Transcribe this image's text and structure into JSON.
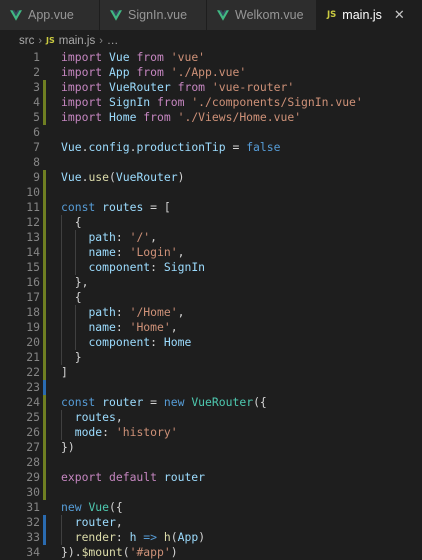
{
  "tabs": [
    {
      "label": "App.vue",
      "type": "vue",
      "active": false
    },
    {
      "label": "SignIn.vue",
      "type": "vue",
      "active": false
    },
    {
      "label": "Welkom.vue",
      "type": "vue",
      "active": false
    },
    {
      "label": "main.js",
      "type": "js",
      "active": true
    }
  ],
  "tab_close_glyph": "✕",
  "file_badge": "JS",
  "breadcrumb": {
    "folder": "src",
    "file": "main.js",
    "more": "…",
    "separator": "›"
  },
  "lines": [
    {
      "n": "1",
      "mark": "",
      "tokens": [
        [
          "kw",
          "import "
        ],
        [
          "id",
          "Vue"
        ],
        [
          "kw",
          " from "
        ],
        [
          "str",
          "'vue'"
        ]
      ]
    },
    {
      "n": "2",
      "mark": "",
      "tokens": [
        [
          "kw",
          "import "
        ],
        [
          "id",
          "App"
        ],
        [
          "kw",
          " from "
        ],
        [
          "str",
          "'./App.vue'"
        ]
      ]
    },
    {
      "n": "3",
      "mark": "g",
      "tokens": [
        [
          "kw",
          "import "
        ],
        [
          "id",
          "VueRouter"
        ],
        [
          "kw",
          " from "
        ],
        [
          "str",
          "'vue-router'"
        ]
      ]
    },
    {
      "n": "4",
      "mark": "g",
      "tokens": [
        [
          "kw",
          "import "
        ],
        [
          "id",
          "SignIn"
        ],
        [
          "kw",
          " from "
        ],
        [
          "str",
          "'./components/SignIn.vue'"
        ]
      ]
    },
    {
      "n": "5",
      "mark": "g",
      "tokens": [
        [
          "kw",
          "import "
        ],
        [
          "id",
          "Home"
        ],
        [
          "kw",
          " from "
        ],
        [
          "str",
          "'./Views/Home.vue'"
        ]
      ]
    },
    {
      "n": "6",
      "mark": "",
      "tokens": []
    },
    {
      "n": "7",
      "mark": "",
      "tokens": [
        [
          "id",
          "Vue"
        ],
        [
          "pl",
          "."
        ],
        [
          "id",
          "config"
        ],
        [
          "pl",
          "."
        ],
        [
          "id",
          "productionTip"
        ],
        [
          "pl",
          " = "
        ],
        [
          "dk",
          "false"
        ]
      ]
    },
    {
      "n": "8",
      "mark": "",
      "tokens": []
    },
    {
      "n": "9",
      "mark": "g",
      "tokens": [
        [
          "id",
          "Vue"
        ],
        [
          "pl",
          "."
        ],
        [
          "fn",
          "use"
        ],
        [
          "pl",
          "("
        ],
        [
          "id",
          "VueRouter"
        ],
        [
          "pl",
          ")"
        ]
      ]
    },
    {
      "n": "10",
      "mark": "g",
      "tokens": []
    },
    {
      "n": "11",
      "mark": "g",
      "tokens": [
        [
          "dk",
          "const "
        ],
        [
          "id",
          "routes"
        ],
        [
          "pl",
          " = ["
        ]
      ]
    },
    {
      "n": "12",
      "mark": "g",
      "tokens": [
        [
          "pl",
          "  {"
        ]
      ]
    },
    {
      "n": "13",
      "mark": "g",
      "tokens": [
        [
          "pl",
          "    "
        ],
        [
          "id",
          "path"
        ],
        [
          "pl",
          ": "
        ],
        [
          "str",
          "'/'"
        ],
        [
          "pl",
          ","
        ]
      ]
    },
    {
      "n": "14",
      "mark": "g",
      "tokens": [
        [
          "pl",
          "    "
        ],
        [
          "id",
          "name"
        ],
        [
          "pl",
          ": "
        ],
        [
          "str",
          "'Login'"
        ],
        [
          "pl",
          ","
        ]
      ]
    },
    {
      "n": "15",
      "mark": "g",
      "tokens": [
        [
          "pl",
          "    "
        ],
        [
          "id",
          "component"
        ],
        [
          "pl",
          ": "
        ],
        [
          "id",
          "SignIn"
        ]
      ]
    },
    {
      "n": "16",
      "mark": "g",
      "tokens": [
        [
          "pl",
          "  },"
        ]
      ]
    },
    {
      "n": "17",
      "mark": "g",
      "tokens": [
        [
          "pl",
          "  {"
        ]
      ]
    },
    {
      "n": "18",
      "mark": "g",
      "tokens": [
        [
          "pl",
          "    "
        ],
        [
          "id",
          "path"
        ],
        [
          "pl",
          ": "
        ],
        [
          "str",
          "'/Home'"
        ],
        [
          "pl",
          ","
        ]
      ]
    },
    {
      "n": "19",
      "mark": "g",
      "tokens": [
        [
          "pl",
          "    "
        ],
        [
          "id",
          "name"
        ],
        [
          "pl",
          ": "
        ],
        [
          "str",
          "'Home'"
        ],
        [
          "pl",
          ","
        ]
      ]
    },
    {
      "n": "20",
      "mark": "g",
      "tokens": [
        [
          "pl",
          "    "
        ],
        [
          "id",
          "component"
        ],
        [
          "pl",
          ": "
        ],
        [
          "id",
          "Home"
        ]
      ]
    },
    {
      "n": "21",
      "mark": "g",
      "tokens": [
        [
          "pl",
          "  }"
        ]
      ]
    },
    {
      "n": "22",
      "mark": "g",
      "tokens": [
        [
          "pl",
          "]"
        ]
      ]
    },
    {
      "n": "23",
      "mark": "b",
      "tokens": []
    },
    {
      "n": "24",
      "mark": "g",
      "tokens": [
        [
          "dk",
          "const "
        ],
        [
          "id",
          "router"
        ],
        [
          "pl",
          " = "
        ],
        [
          "dk",
          "new "
        ],
        [
          "cls",
          "VueRouter"
        ],
        [
          "pl",
          "({"
        ]
      ]
    },
    {
      "n": "25",
      "mark": "g",
      "tokens": [
        [
          "pl",
          "  "
        ],
        [
          "id",
          "routes"
        ],
        [
          "pl",
          ","
        ]
      ]
    },
    {
      "n": "26",
      "mark": "g",
      "tokens": [
        [
          "pl",
          "  "
        ],
        [
          "id",
          "mode"
        ],
        [
          "pl",
          ": "
        ],
        [
          "str",
          "'history'"
        ]
      ]
    },
    {
      "n": "27",
      "mark": "g",
      "tokens": [
        [
          "pl",
          "})"
        ]
      ]
    },
    {
      "n": "28",
      "mark": "g",
      "tokens": []
    },
    {
      "n": "29",
      "mark": "g",
      "tokens": [
        [
          "kw",
          "export default "
        ],
        [
          "id",
          "router"
        ]
      ]
    },
    {
      "n": "30",
      "mark": "g",
      "tokens": []
    },
    {
      "n": "31",
      "mark": "",
      "tokens": [
        [
          "dk",
          "new "
        ],
        [
          "cls",
          "Vue"
        ],
        [
          "pl",
          "({"
        ]
      ]
    },
    {
      "n": "32",
      "mark": "b",
      "tokens": [
        [
          "pl",
          "  "
        ],
        [
          "id",
          "router"
        ],
        [
          "pl",
          ","
        ]
      ]
    },
    {
      "n": "33",
      "mark": "b",
      "tokens": [
        [
          "pl",
          "  "
        ],
        [
          "fn",
          "render"
        ],
        [
          "pl",
          ": "
        ],
        [
          "id",
          "h"
        ],
        [
          "dk",
          " => "
        ],
        [
          "fn",
          "h"
        ],
        [
          "pl",
          "("
        ],
        [
          "id",
          "App"
        ],
        [
          "pl",
          ")"
        ]
      ]
    },
    {
      "n": "34",
      "mark": "",
      "tokens": [
        [
          "pl",
          "})."
        ],
        [
          "fn",
          "$mount"
        ],
        [
          "pl",
          "("
        ],
        [
          "str",
          "'#app'"
        ],
        [
          "pl",
          ")"
        ]
      ]
    }
  ]
}
